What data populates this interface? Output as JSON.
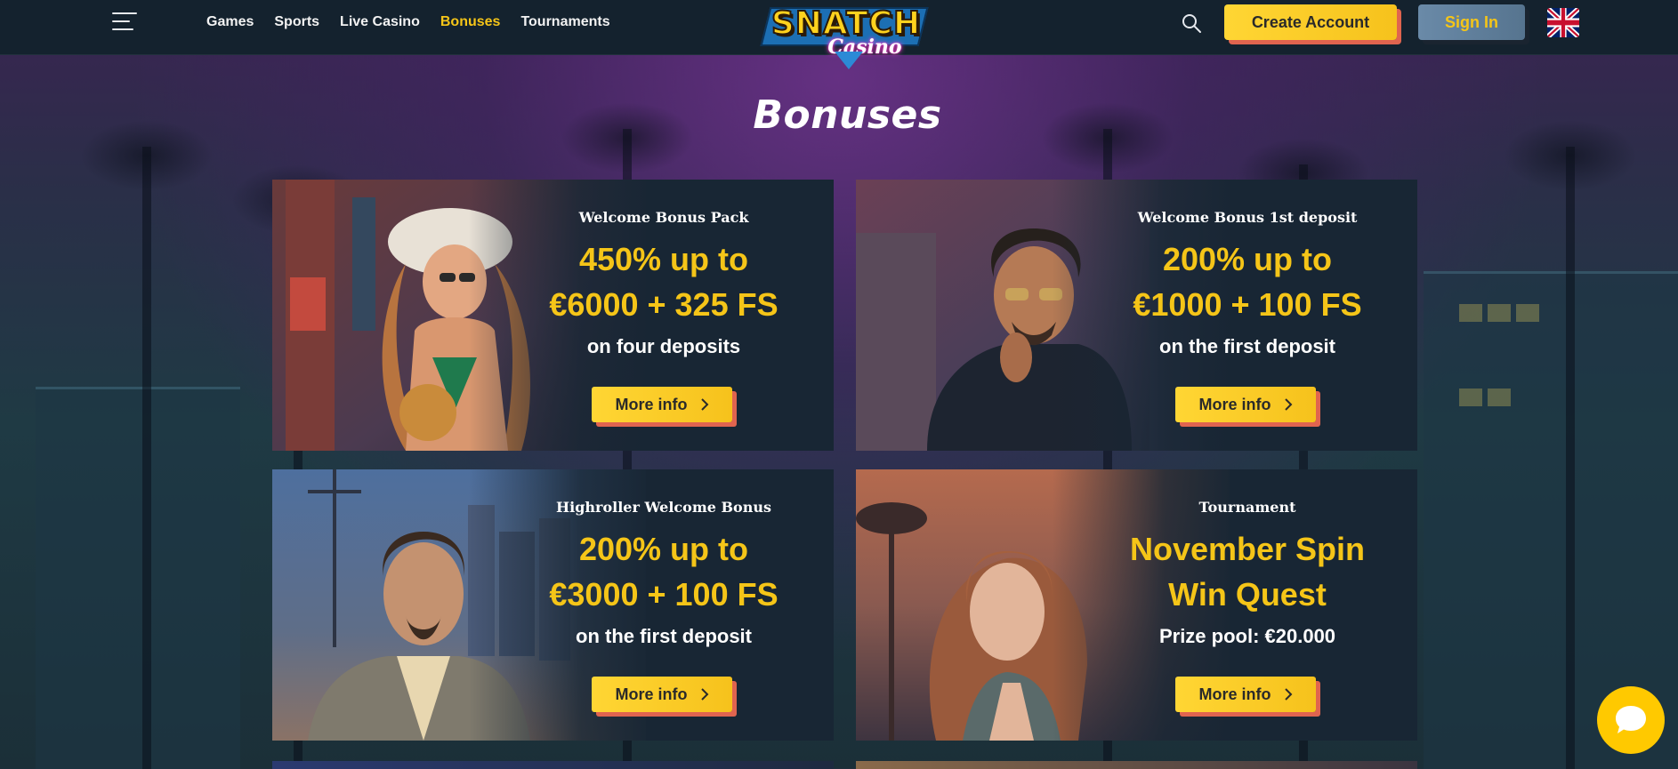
{
  "nav": {
    "items": [
      {
        "label": "Games",
        "active": false
      },
      {
        "label": "Sports",
        "active": false
      },
      {
        "label": "Live Casino",
        "active": false
      },
      {
        "label": "Bonuses",
        "active": true
      },
      {
        "label": "Tournaments",
        "active": false
      }
    ]
  },
  "logo": {
    "line1": "SNATCH",
    "line2": "Casino"
  },
  "header": {
    "create_account": "Create Account",
    "sign_in": "Sign In",
    "language_icon": "uk-flag-icon"
  },
  "page": {
    "title": "Bonuses"
  },
  "cards": [
    {
      "label": "Welcome Bonus Pack",
      "headline_1": "450% up to",
      "headline_2": "€6000 + 325 FS",
      "sub": "on four deposits",
      "button": "More info"
    },
    {
      "label": "Welcome Bonus 1st deposit",
      "headline_1": "200% up to",
      "headline_2": "€1000 + 100 FS",
      "sub": "on the first deposit",
      "button": "More info"
    },
    {
      "label": "Highroller Welcome Bonus",
      "headline_1": "200% up to",
      "headline_2": "€3000 + 100 FS",
      "sub": "on the first deposit",
      "button": "More info"
    },
    {
      "label": "Tournament",
      "headline_1": "November Spin",
      "headline_2": "Win Quest",
      "sub": "Prize pool: €20.000",
      "button": "More info"
    }
  ],
  "colors": {
    "accent": "#f5c518",
    "header_bg": "#14222e",
    "card_bg": "#182634",
    "button_shadow": "#e0644f"
  }
}
